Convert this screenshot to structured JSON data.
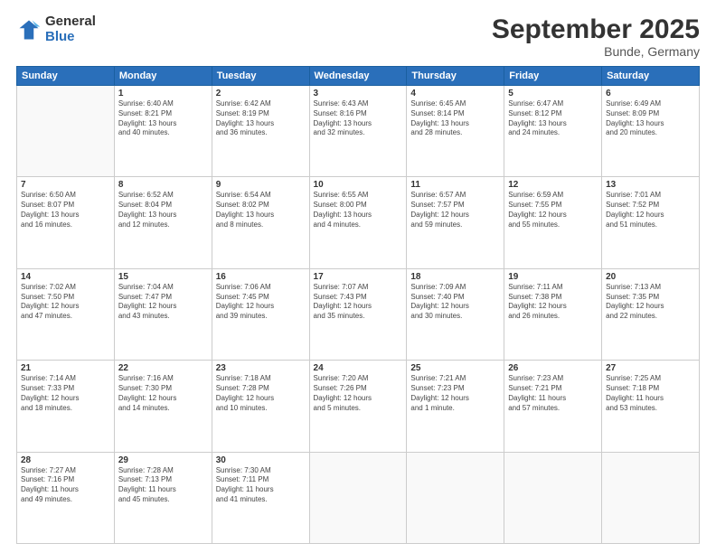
{
  "logo": {
    "general": "General",
    "blue": "Blue"
  },
  "header": {
    "month": "September 2025",
    "location": "Bunde, Germany"
  },
  "weekdays": [
    "Sunday",
    "Monday",
    "Tuesday",
    "Wednesday",
    "Thursday",
    "Friday",
    "Saturday"
  ],
  "weeks": [
    [
      {
        "day": "",
        "info": ""
      },
      {
        "day": "1",
        "info": "Sunrise: 6:40 AM\nSunset: 8:21 PM\nDaylight: 13 hours\nand 40 minutes."
      },
      {
        "day": "2",
        "info": "Sunrise: 6:42 AM\nSunset: 8:19 PM\nDaylight: 13 hours\nand 36 minutes."
      },
      {
        "day": "3",
        "info": "Sunrise: 6:43 AM\nSunset: 8:16 PM\nDaylight: 13 hours\nand 32 minutes."
      },
      {
        "day": "4",
        "info": "Sunrise: 6:45 AM\nSunset: 8:14 PM\nDaylight: 13 hours\nand 28 minutes."
      },
      {
        "day": "5",
        "info": "Sunrise: 6:47 AM\nSunset: 8:12 PM\nDaylight: 13 hours\nand 24 minutes."
      },
      {
        "day": "6",
        "info": "Sunrise: 6:49 AM\nSunset: 8:09 PM\nDaylight: 13 hours\nand 20 minutes."
      }
    ],
    [
      {
        "day": "7",
        "info": "Sunrise: 6:50 AM\nSunset: 8:07 PM\nDaylight: 13 hours\nand 16 minutes."
      },
      {
        "day": "8",
        "info": "Sunrise: 6:52 AM\nSunset: 8:04 PM\nDaylight: 13 hours\nand 12 minutes."
      },
      {
        "day": "9",
        "info": "Sunrise: 6:54 AM\nSunset: 8:02 PM\nDaylight: 13 hours\nand 8 minutes."
      },
      {
        "day": "10",
        "info": "Sunrise: 6:55 AM\nSunset: 8:00 PM\nDaylight: 13 hours\nand 4 minutes."
      },
      {
        "day": "11",
        "info": "Sunrise: 6:57 AM\nSunset: 7:57 PM\nDaylight: 12 hours\nand 59 minutes."
      },
      {
        "day": "12",
        "info": "Sunrise: 6:59 AM\nSunset: 7:55 PM\nDaylight: 12 hours\nand 55 minutes."
      },
      {
        "day": "13",
        "info": "Sunrise: 7:01 AM\nSunset: 7:52 PM\nDaylight: 12 hours\nand 51 minutes."
      }
    ],
    [
      {
        "day": "14",
        "info": "Sunrise: 7:02 AM\nSunset: 7:50 PM\nDaylight: 12 hours\nand 47 minutes."
      },
      {
        "day": "15",
        "info": "Sunrise: 7:04 AM\nSunset: 7:47 PM\nDaylight: 12 hours\nand 43 minutes."
      },
      {
        "day": "16",
        "info": "Sunrise: 7:06 AM\nSunset: 7:45 PM\nDaylight: 12 hours\nand 39 minutes."
      },
      {
        "day": "17",
        "info": "Sunrise: 7:07 AM\nSunset: 7:43 PM\nDaylight: 12 hours\nand 35 minutes."
      },
      {
        "day": "18",
        "info": "Sunrise: 7:09 AM\nSunset: 7:40 PM\nDaylight: 12 hours\nand 30 minutes."
      },
      {
        "day": "19",
        "info": "Sunrise: 7:11 AM\nSunset: 7:38 PM\nDaylight: 12 hours\nand 26 minutes."
      },
      {
        "day": "20",
        "info": "Sunrise: 7:13 AM\nSunset: 7:35 PM\nDaylight: 12 hours\nand 22 minutes."
      }
    ],
    [
      {
        "day": "21",
        "info": "Sunrise: 7:14 AM\nSunset: 7:33 PM\nDaylight: 12 hours\nand 18 minutes."
      },
      {
        "day": "22",
        "info": "Sunrise: 7:16 AM\nSunset: 7:30 PM\nDaylight: 12 hours\nand 14 minutes."
      },
      {
        "day": "23",
        "info": "Sunrise: 7:18 AM\nSunset: 7:28 PM\nDaylight: 12 hours\nand 10 minutes."
      },
      {
        "day": "24",
        "info": "Sunrise: 7:20 AM\nSunset: 7:26 PM\nDaylight: 12 hours\nand 5 minutes."
      },
      {
        "day": "25",
        "info": "Sunrise: 7:21 AM\nSunset: 7:23 PM\nDaylight: 12 hours\nand 1 minute."
      },
      {
        "day": "26",
        "info": "Sunrise: 7:23 AM\nSunset: 7:21 PM\nDaylight: 11 hours\nand 57 minutes."
      },
      {
        "day": "27",
        "info": "Sunrise: 7:25 AM\nSunset: 7:18 PM\nDaylight: 11 hours\nand 53 minutes."
      }
    ],
    [
      {
        "day": "28",
        "info": "Sunrise: 7:27 AM\nSunset: 7:16 PM\nDaylight: 11 hours\nand 49 minutes."
      },
      {
        "day": "29",
        "info": "Sunrise: 7:28 AM\nSunset: 7:13 PM\nDaylight: 11 hours\nand 45 minutes."
      },
      {
        "day": "30",
        "info": "Sunrise: 7:30 AM\nSunset: 7:11 PM\nDaylight: 11 hours\nand 41 minutes."
      },
      {
        "day": "",
        "info": ""
      },
      {
        "day": "",
        "info": ""
      },
      {
        "day": "",
        "info": ""
      },
      {
        "day": "",
        "info": ""
      }
    ]
  ]
}
